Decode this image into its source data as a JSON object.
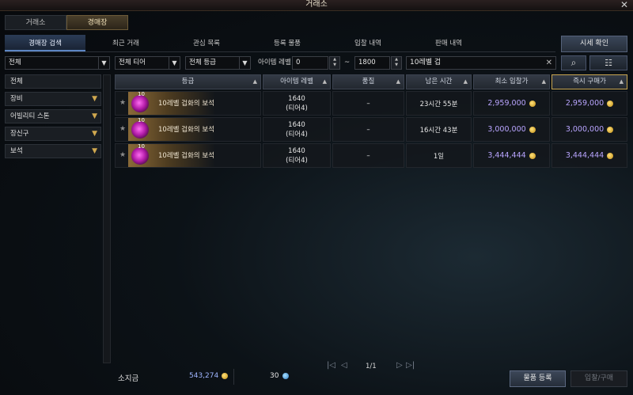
{
  "window": {
    "title": "거래소",
    "close_glyph": "✕"
  },
  "top_tabs": [
    {
      "label": "거래소",
      "active": false
    },
    {
      "label": "경매장",
      "active": true
    }
  ],
  "sub_tabs": [
    {
      "label": "경매장 검색",
      "active": true
    },
    {
      "label": "최근 거래",
      "active": false
    },
    {
      "label": "관심 목록",
      "active": false
    },
    {
      "label": "등록 물품",
      "active": false
    },
    {
      "label": "입찰 내역",
      "active": false
    },
    {
      "label": "판매 내역",
      "active": false
    }
  ],
  "detail_button": "시세 확인",
  "filters": {
    "category": "전체",
    "tier": "전체 티어",
    "grade": "전체 등급",
    "item_level_label": "아이템 레벨",
    "level_min": "0",
    "range_sep": "~",
    "level_max": "1800",
    "search_text": "10레벨 겁",
    "clear_glyph": "✕"
  },
  "icons": {
    "search": "⌕",
    "filter": "☷"
  },
  "sidebar": [
    {
      "label": "전체",
      "has_chevron": false
    },
    {
      "label": "장비",
      "has_chevron": true
    },
    {
      "label": "어빌리티 스톤",
      "has_chevron": true
    },
    {
      "label": "장신구",
      "has_chevron": true
    },
    {
      "label": "보석",
      "has_chevron": true
    }
  ],
  "columns": [
    {
      "label": "등급",
      "sort": "▲"
    },
    {
      "label": "아이템 레벨",
      "sort": "▲"
    },
    {
      "label": "품질",
      "sort": "▲"
    },
    {
      "label": "남은 시간",
      "sort": "▲"
    },
    {
      "label": "최소 입찰가",
      "sort": "▲"
    },
    {
      "label": "즉시 구매가",
      "sort": "▲"
    }
  ],
  "rows": [
    {
      "gem_level": "10",
      "name": "10레벨 겁화의 보석",
      "level": "1640",
      "tier": "(티어4)",
      "quality": "–",
      "time_left": "23시간 55분",
      "min_bid": "2,959,000",
      "buy_now": "2,959,000"
    },
    {
      "gem_level": "10",
      "name": "10레벨 겁화의 보석",
      "level": "1640",
      "tier": "(티어4)",
      "quality": "–",
      "time_left": "16시간 43분",
      "min_bid": "3,000,000",
      "buy_now": "3,000,000"
    },
    {
      "gem_level": "10",
      "name": "10레벨 겁화의 보석",
      "level": "1640",
      "tier": "(티어4)",
      "quality": "–",
      "time_left": "1일",
      "min_bid": "3,444,444",
      "buy_now": "3,444,444"
    }
  ],
  "footer": {
    "money_label": "소지금",
    "gold": "543,274",
    "crystals": "30",
    "page": "1/1",
    "register_button": "물품 등록",
    "buy_button": "입찰/구매"
  },
  "colors": {
    "accent_gold": "#c8a551",
    "price_purple": "#b9a5ff",
    "tab_active_blue": "#2b3c56"
  }
}
